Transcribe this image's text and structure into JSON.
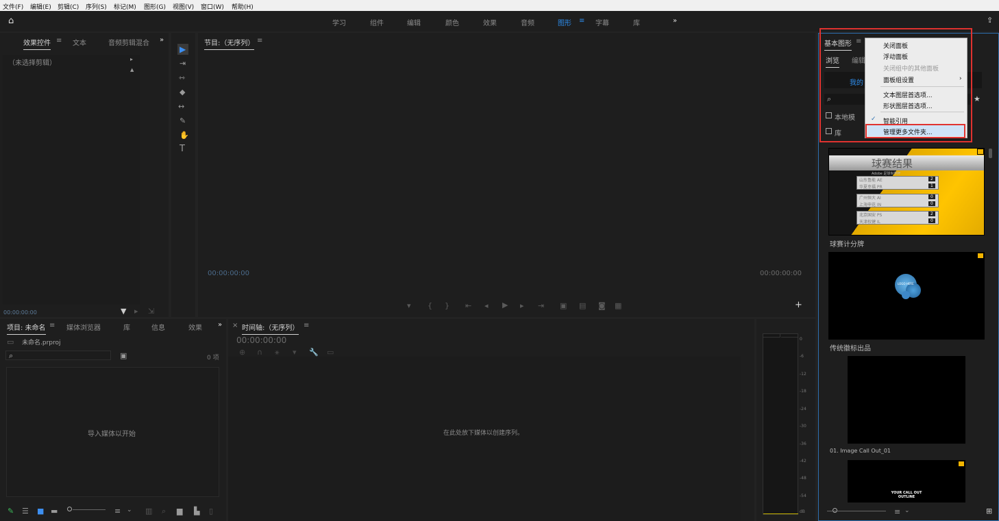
{
  "menu": [
    "文件(F)",
    "编辑(E)",
    "剪辑(C)",
    "序列(S)",
    "标记(M)",
    "图形(G)",
    "视图(V)",
    "窗口(W)",
    "帮助(H)"
  ],
  "workspaces": [
    "学习",
    "组件",
    "编辑",
    "颜色",
    "效果",
    "音频",
    "图形",
    "字幕",
    "库"
  ],
  "workspace_active": "图形",
  "effects_panel": {
    "tabs": [
      "效果控件",
      "文本",
      "音频剪辑混合器"
    ],
    "no_clip": "（未选择剪辑）",
    "timecode": "00:00:00:00"
  },
  "program": {
    "title": "节目:（无序列）",
    "tc_left": "00:00:00:00",
    "tc_right": "00:00:00:00"
  },
  "project": {
    "tabs": [
      "项目: 未命名",
      "媒体浏览器",
      "库",
      "信息",
      "效果"
    ],
    "file": "未命名.prproj",
    "count": "0 项",
    "empty": "导入媒体以开始"
  },
  "timeline": {
    "title": "时间轴:（无序列）",
    "timecode": "00:00:00:00",
    "empty": "在此处放下媒体以创建序列。"
  },
  "meter": {
    "labels": [
      "0",
      "-6",
      "-12",
      "-18",
      "-24",
      "-30",
      "-36",
      "-42",
      "-48",
      "-54",
      "dB"
    ]
  },
  "eg": {
    "title": "基本图形",
    "tab_browse": "浏览",
    "tab_edit": "编辑",
    "my_templates": "我的",
    "local": "本地模",
    "lib": "库",
    "items": [
      "球赛计分牌",
      "传统徽标出品",
      "01. Image Call Out_01"
    ],
    "score": {
      "title": "球赛结果",
      "sub": "Adobe 足球世界杯",
      "rows": [
        [
          "山东鲁能 AE",
          "2"
        ],
        [
          "华夏幸福 PR",
          "1"
        ],
        [
          "广州恒大 AI",
          "0"
        ],
        [
          "上海申花 IN",
          "0"
        ],
        [
          "北京国安 PS",
          "2"
        ],
        [
          "天津权健 IL",
          "0"
        ]
      ]
    },
    "logo_text": "LOGO HERE",
    "outline": "YOUR CALL OUT OUTLINE"
  },
  "context_menu": {
    "items": [
      "关闭面板",
      "浮动面板",
      "关闭组中的其他面板",
      "面板组设置",
      "文本图层首选项...",
      "形状图层首选项...",
      "智能引用",
      "管理更多文件夹..."
    ]
  },
  "colors": {
    "accent": "#2d8ceb",
    "highlight": "#cfe3f7",
    "red": "#e0322f"
  }
}
